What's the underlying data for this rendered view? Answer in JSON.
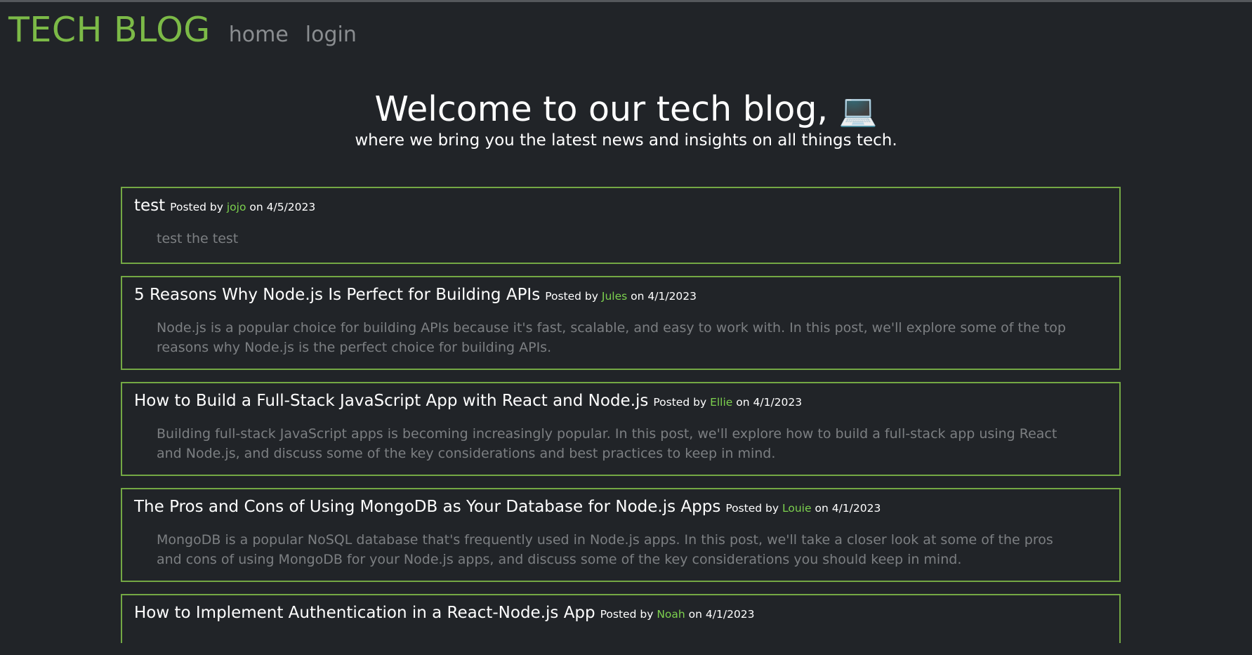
{
  "nav": {
    "brand": "TECH BLOG",
    "links": [
      {
        "label": "home"
      },
      {
        "label": "login"
      }
    ]
  },
  "hero": {
    "title": "Welcome to our tech blog,",
    "emoji": "💻",
    "subtitle": "where we bring you the latest news and insights on all things tech."
  },
  "posts": [
    {
      "title": "test",
      "posted_by_label": "Posted by",
      "author": "jojo",
      "on_label": "on",
      "date": "4/5/2023",
      "body": "test the test"
    },
    {
      "title": "5 Reasons Why Node.js Is Perfect for Building APIs",
      "posted_by_label": "Posted by",
      "author": "Jules",
      "on_label": "on",
      "date": "4/1/2023",
      "body": "Node.js is a popular choice for building APIs because it's fast, scalable, and easy to work with. In this post, we'll explore some of the top reasons why Node.js is the perfect choice for building APIs."
    },
    {
      "title": "How to Build a Full-Stack JavaScript App with React and Node.js",
      "posted_by_label": "Posted by",
      "author": "Ellie",
      "on_label": "on",
      "date": "4/1/2023",
      "body": "Building full-stack JavaScript apps is becoming increasingly popular. In this post, we'll explore how to build a full-stack app using React and Node.js, and discuss some of the key considerations and best practices to keep in mind."
    },
    {
      "title": "The Pros and Cons of Using MongoDB as Your Database for Node.js Apps",
      "posted_by_label": "Posted by",
      "author": "Louie",
      "on_label": "on",
      "date": "4/1/2023",
      "body": "MongoDB is a popular NoSQL database that's frequently used in Node.js apps. In this post, we'll take a closer look at some of the pros and cons of using MongoDB for your Node.js apps, and discuss some of the key considerations you should keep in mind."
    },
    {
      "title": "How to Implement Authentication in a React-Node.js App",
      "posted_by_label": "Posted by",
      "author": "Noah",
      "on_label": "on",
      "date": "4/1/2023"
    }
  ],
  "colors": {
    "background": "#212428",
    "brand": "#7cba47",
    "author": "#7cd14e",
    "border": "#74a844",
    "muted_text": "#7c7f82",
    "nav_link": "#8a8d90"
  }
}
